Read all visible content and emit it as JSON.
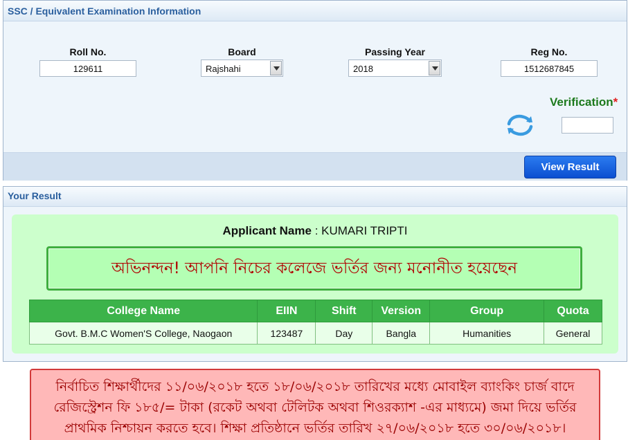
{
  "info_panel": {
    "title": "SSC / Equivalent Examination Information",
    "roll": {
      "label": "Roll No.",
      "value": "129611"
    },
    "board": {
      "label": "Board",
      "selected": "Rajshahi"
    },
    "passing_year": {
      "label": "Passing Year",
      "selected": "2018"
    },
    "reg": {
      "label": "Reg No.",
      "value": "1512687845"
    },
    "verification": {
      "label": "Verification",
      "required_mark": "*",
      "value": ""
    },
    "view_button": "View Result"
  },
  "result_panel": {
    "title": "Your Result",
    "applicant_label": "Applicant Name",
    "applicant_separator": " : ",
    "applicant_name": "KUMARI TRIPTI",
    "congrats": "অভিনন্দন! আপনি নিচের কলেজে ভর্তির জন্য মনোনীত হয়েছেন",
    "table": {
      "headers": [
        "College Name",
        "EIIN",
        "Shift",
        "Version",
        "Group",
        "Quota"
      ],
      "rows": [
        [
          "Govt. B.M.C Women'S College, Naogaon",
          "123487",
          "Day",
          "Bangla",
          "Humanities",
          "General"
        ]
      ]
    }
  },
  "notice": "নির্বাচিত শিক্ষার্থীদের ১১/০৬/২০১৮ হতে ১৮/০৬/২০১৮ তারিখের মধ্যে মোবাইল ব্যাংকিং চার্জ বাদে রেজিস্ট্রেশন ফি ১৮৫/= টাকা (রকেট অথবা টেলিটক অথবা শিওরক্যাশ -এর মাধ্যমে) জমা দিয়ে ভর্তির প্রাথমিক নিশ্চায়ন করতে হবে। শিক্ষা প্রতিষ্ঠানে ভর্তির তারিখ ২৭/০৬/২০১৮ হতে ৩০/০৬/২০১৮।",
  "icons": {
    "select_arrow": "chevron-down-icon",
    "refresh": "refresh-icon"
  },
  "colors": {
    "panel_title": "#2a5f9e",
    "verification_label": "#1d7a1d",
    "view_button": "#0b4fd1",
    "table_header": "#3cb34a",
    "congrats_text": "#b00000",
    "notice_bg": "#ffb8b8"
  }
}
